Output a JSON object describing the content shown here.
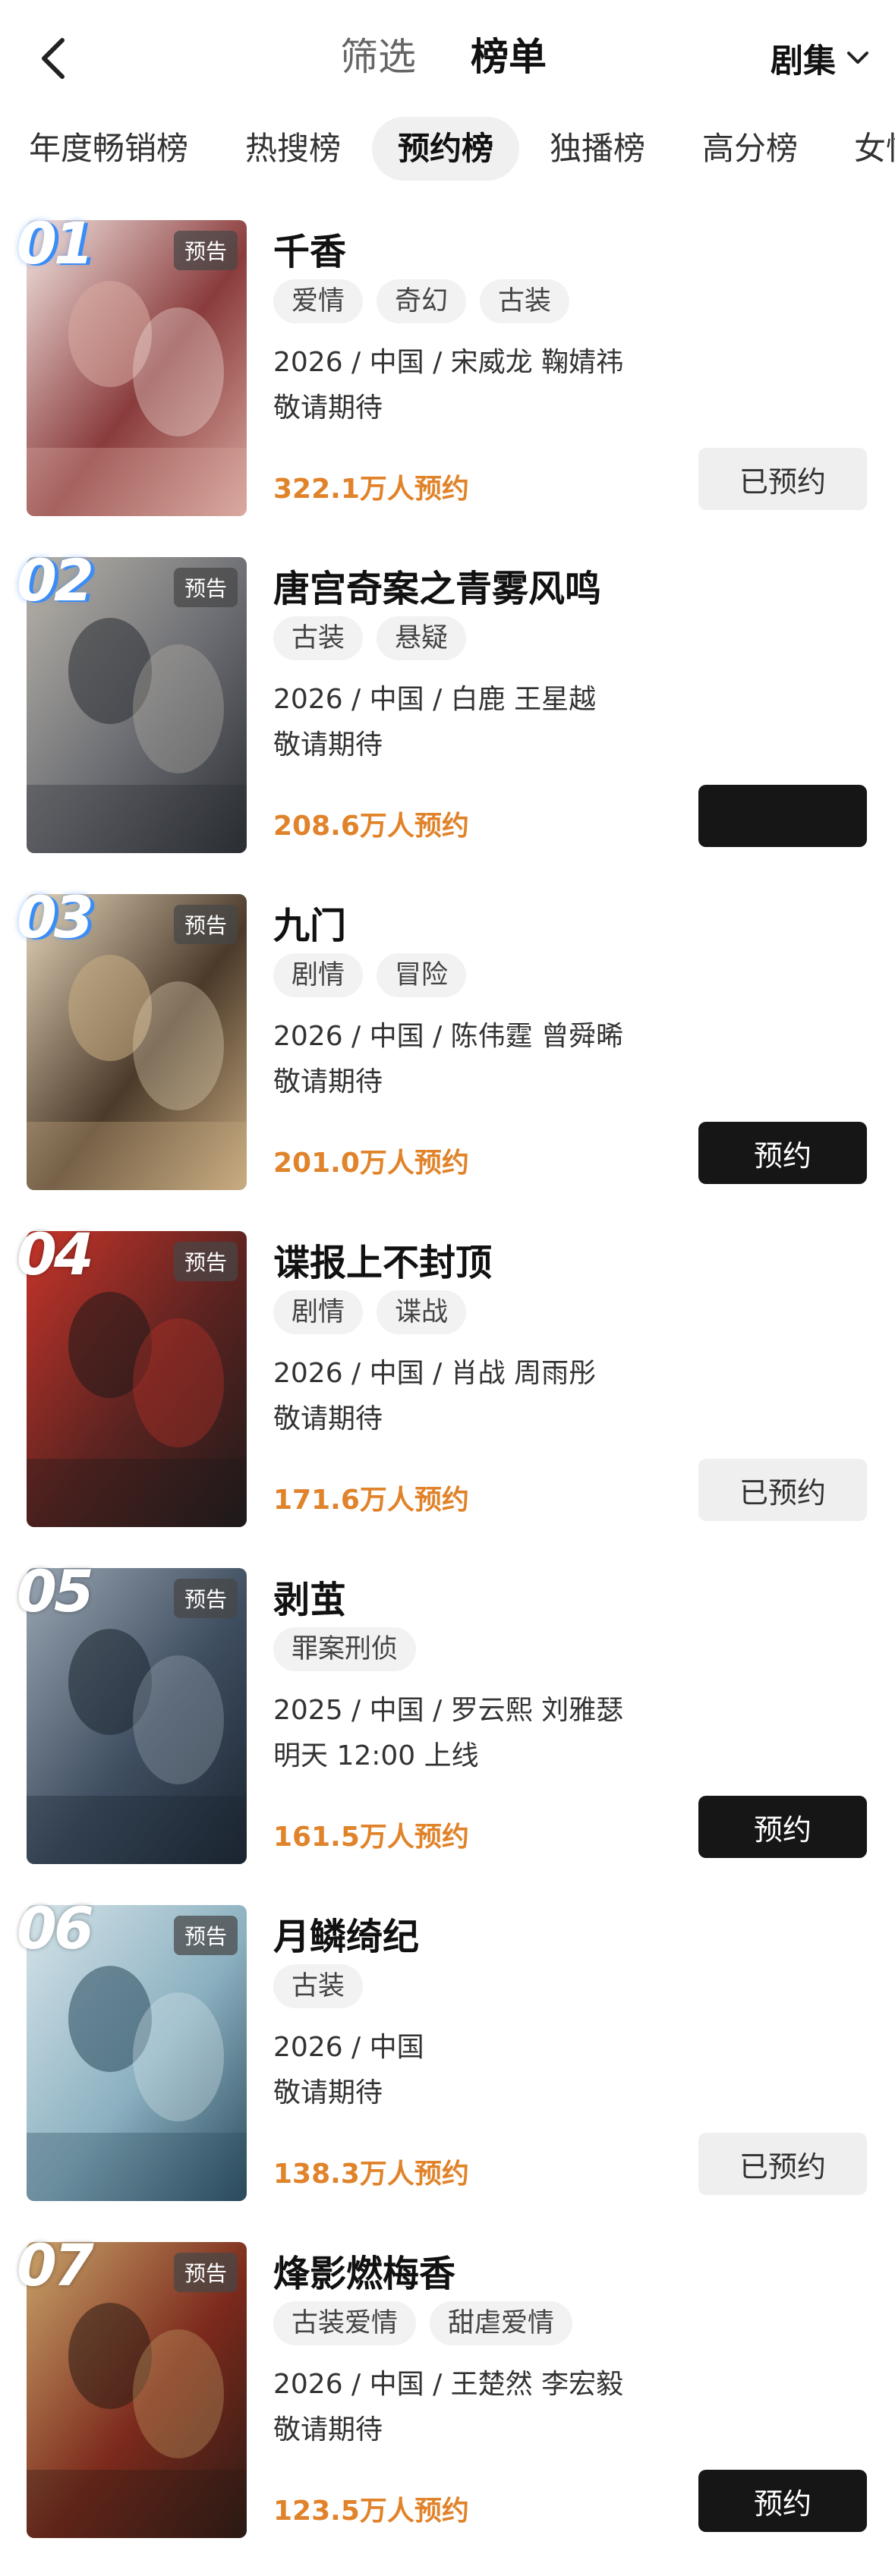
{
  "header": {
    "filter_label": "筛选",
    "rank_label": "榜单",
    "type_label": "剧集"
  },
  "tabs": [
    {
      "label": "年度畅销榜"
    },
    {
      "label": "热搜榜"
    },
    {
      "label": "预约榜",
      "active": true
    },
    {
      "label": "独播榜"
    },
    {
      "label": "高分榜"
    },
    {
      "label": "女性"
    }
  ],
  "items": [
    {
      "rank": "01",
      "badge": "预告",
      "title": "千香",
      "tags": [
        "爱情",
        "奇幻",
        "古装"
      ],
      "meta": "2026 / 中国 / 宋威龙 鞠婧祎",
      "status": "敬请期待",
      "count": "322.1万人预约",
      "button": "已预约",
      "button_state": "booked",
      "colors": [
        "#d9a9a0",
        "#8a3c3c",
        "#f3e6e3"
      ]
    },
    {
      "rank": "02",
      "badge": "预告",
      "title": "唐宫奇案之青雾风鸣",
      "tags": [
        "古装",
        "悬疑"
      ],
      "meta": "2026 / 中国 / 白鹿 王星越",
      "status": "敬请期待",
      "count": "208.6万人预约",
      "button": "",
      "button_state": "book",
      "colors": [
        "#2a2d33",
        "#6a6c72",
        "#b9b4aa"
      ]
    },
    {
      "rank": "03",
      "badge": "预告",
      "title": "九门",
      "tags": [
        "剧情",
        "冒险"
      ],
      "meta": "2026 / 中国 / 陈伟霆 曾舜晞",
      "status": "敬请期待",
      "count": "201.0万人预约",
      "button": "预约",
      "button_state": "book",
      "colors": [
        "#c9ad82",
        "#4b3a2a",
        "#e6d6bb"
      ]
    },
    {
      "rank": "04",
      "badge": "预告",
      "title": "谍报上不封顶",
      "tags": [
        "剧情",
        "谍战"
      ],
      "meta": "2026 / 中国 / 肖战 周雨彤",
      "status": "敬请期待",
      "count": "171.6万人预约",
      "button": "已预约",
      "button_state": "booked",
      "colors": [
        "#1e1a1a",
        "#5a2320",
        "#c7342a"
      ]
    },
    {
      "rank": "05",
      "badge": "预告",
      "title": "剥茧",
      "tags": [
        "罪案刑侦"
      ],
      "meta": "2025 / 中国 / 罗云熙 刘雅瑟",
      "status": "明天 12:00 上线",
      "count": "161.5万人预约",
      "button": "预约",
      "button_state": "book",
      "colors": [
        "#1b2430",
        "#3f4e60",
        "#9aa6b3"
      ]
    },
    {
      "rank": "06",
      "badge": "预告",
      "title": "月鳞绮纪",
      "tags": [
        "古装"
      ],
      "meta": "2026 / 中国",
      "status": "敬请期待",
      "count": "138.3万人预约",
      "button": "已预约",
      "button_state": "booked",
      "colors": [
        "#2a4a5c",
        "#8bb0c0",
        "#d6e4ea"
      ]
    },
    {
      "rank": "07",
      "badge": "预告",
      "title": "烽影燃梅香",
      "tags": [
        "古装爱情",
        "甜虐爱情"
      ],
      "meta": "2026 / 中国 / 王楚然 李宏毅",
      "status": "敬请期待",
      "count": "123.5万人预约",
      "button": "预约",
      "button_state": "book",
      "colors": [
        "#2b1a14",
        "#7c2a1c",
        "#c9a46a"
      ]
    }
  ]
}
